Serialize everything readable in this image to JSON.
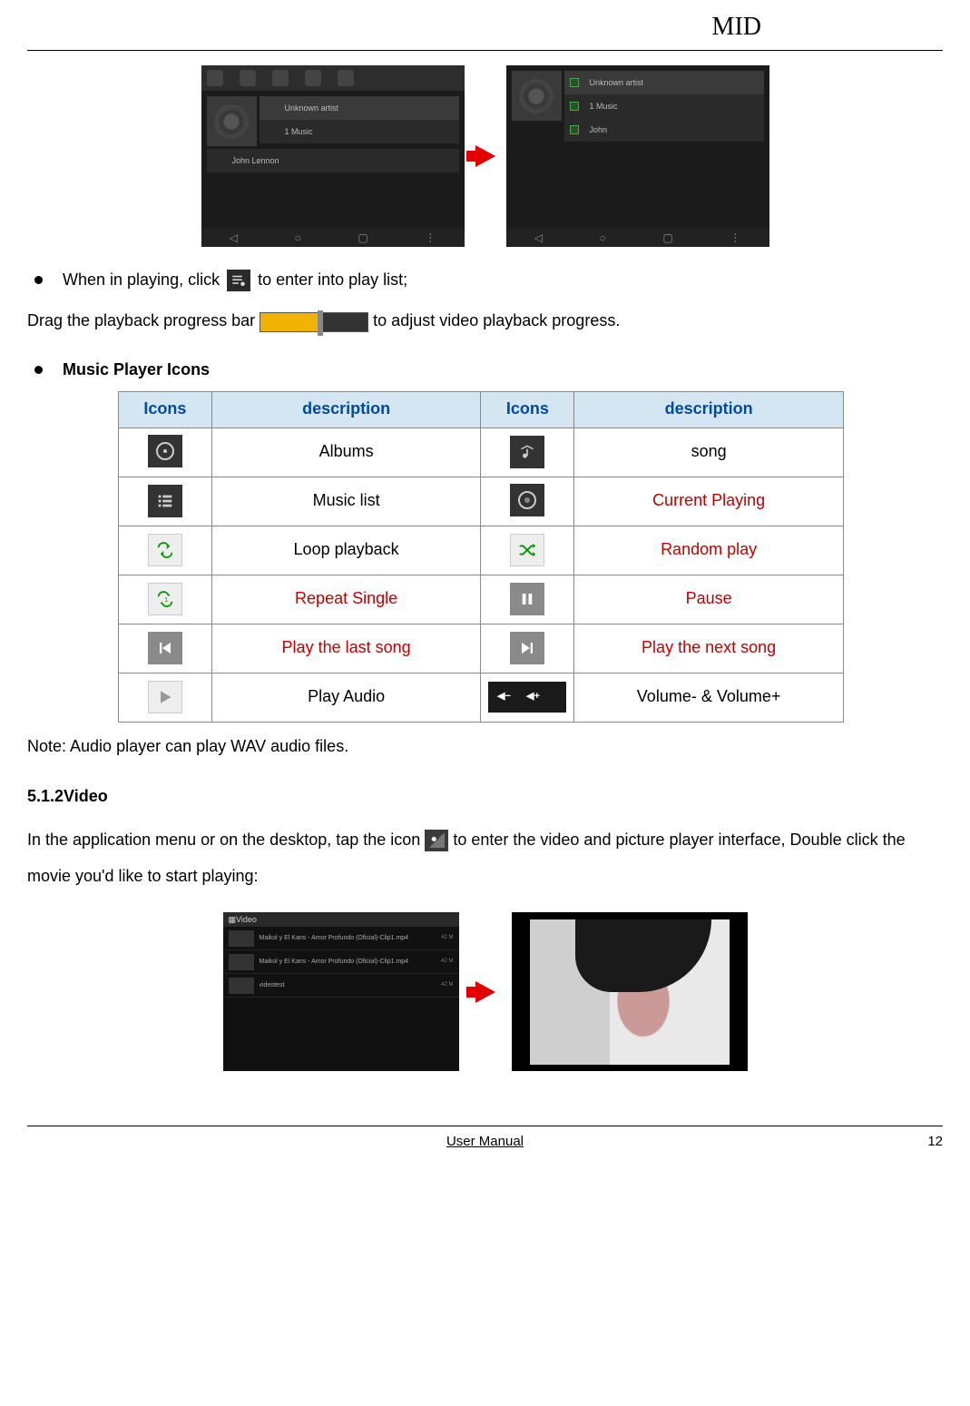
{
  "header": {
    "title": "MID"
  },
  "screenshots_top": {
    "left": {
      "rows": [
        "Unknown artist",
        "1 Music",
        "John Lennon"
      ]
    },
    "right": {
      "rows": [
        "Unknown artist",
        "1 Music",
        "John"
      ]
    }
  },
  "bullet1_prefix": "When in playing, click",
  "bullet1_suffix": "to enter into play list;",
  "drag_prefix": "Drag the playback progress bar",
  "drag_suffix": "to adjust video playback progress.",
  "section_music_icons": "Music Player Icons",
  "table": {
    "headers": [
      "Icons",
      "description",
      "Icons",
      "description"
    ],
    "rows": [
      {
        "d1": "Albums",
        "d2": "song",
        "d1_red": false,
        "d2_red": false
      },
      {
        "d1": "Music list",
        "d2": "Current Playing",
        "d1_red": false,
        "d2_red": true
      },
      {
        "d1": "Loop playback",
        "d2": "Random play",
        "d1_red": false,
        "d2_red": true
      },
      {
        "d1": "Repeat Single",
        "d2": "Pause",
        "d1_red": true,
        "d2_red": true
      },
      {
        "d1": "Play the last song",
        "d2": "Play the next song",
        "d1_red": true,
        "d2_red": true
      },
      {
        "d1": "Play Audio",
        "d2": "Volume- & Volume+",
        "d1_red": false,
        "d2_red": false
      }
    ]
  },
  "note": "Note: Audio player can play WAV audio files.",
  "video_heading": "5.1.2Video",
  "video_para_prefix": "In the application menu or on the desktop, tap the icon",
  "video_para_suffix": "to enter the video and picture player interface, Double click the movie you'd like to start playing:",
  "video_list_title": "Video",
  "video_rows": [
    {
      "name": "Maikol y El Kans - Amor Profundo (Oficial)-Clip1.mp4",
      "meta": "42 M"
    },
    {
      "name": "Maikol y El Kans - Amor Profundo (Oficial)-Clip1.mp4",
      "meta": "42 M"
    },
    {
      "name": "videotest",
      "meta": "42 M"
    }
  ],
  "footer": {
    "center": "User Manual",
    "page": "12"
  }
}
